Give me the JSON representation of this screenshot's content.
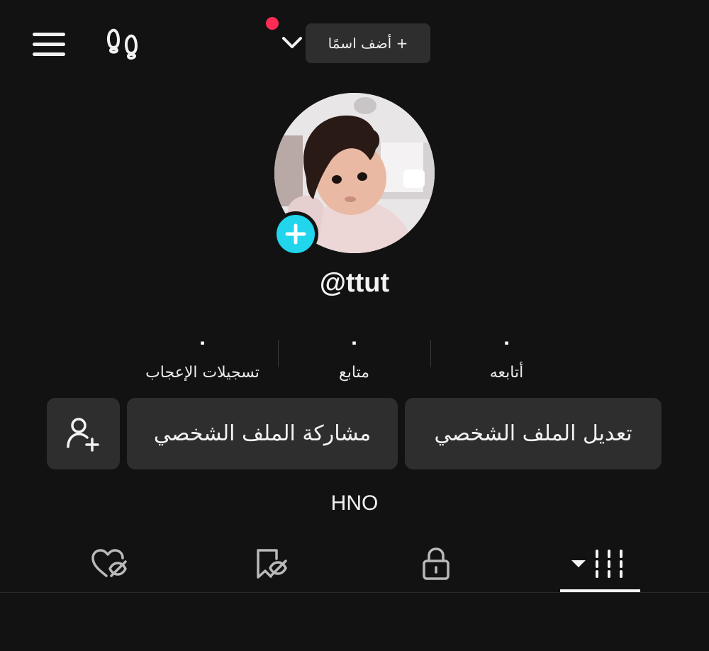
{
  "header": {
    "add_name_label": "+ أضف اسمًا",
    "notification_dot_color": "#ff2b54"
  },
  "profile": {
    "username": "@ttut",
    "avatar_description_icon": "profile-photo",
    "add_photo_color": "#20d5ec",
    "bio": "HNO"
  },
  "stats": {
    "likes": {
      "value": "٠",
      "label": "تسجيلات الإعجاب"
    },
    "followers": {
      "value": "٠",
      "label": "متابع"
    },
    "following": {
      "value": "٠",
      "label": "أتابعه"
    }
  },
  "actions": {
    "edit_profile": "تعديل الملف الشخصي",
    "share_profile": "مشاركة الملف الشخصي"
  },
  "tabs": {
    "active": "videos",
    "items": [
      "videos",
      "private",
      "reposts",
      "liked"
    ]
  }
}
